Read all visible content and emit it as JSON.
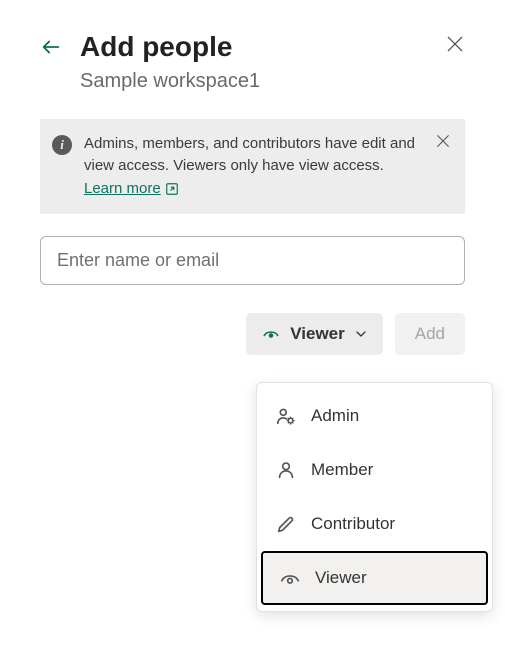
{
  "header": {
    "title": "Add people",
    "subtitle": "Sample workspace1"
  },
  "info": {
    "message": "Admins, members, and contributors have edit and view access. Viewers only have view access. ",
    "learn_label": "Learn more "
  },
  "input": {
    "placeholder": "Enter name or email"
  },
  "actions": {
    "role_selected": "Viewer",
    "add_label": "Add"
  },
  "roles": [
    {
      "key": "admin",
      "label": "Admin",
      "icon": "admin"
    },
    {
      "key": "member",
      "label": "Member",
      "icon": "member"
    },
    {
      "key": "contributor",
      "label": "Contributor",
      "icon": "contributor"
    },
    {
      "key": "viewer",
      "label": "Viewer",
      "icon": "viewer",
      "selected": true
    }
  ]
}
